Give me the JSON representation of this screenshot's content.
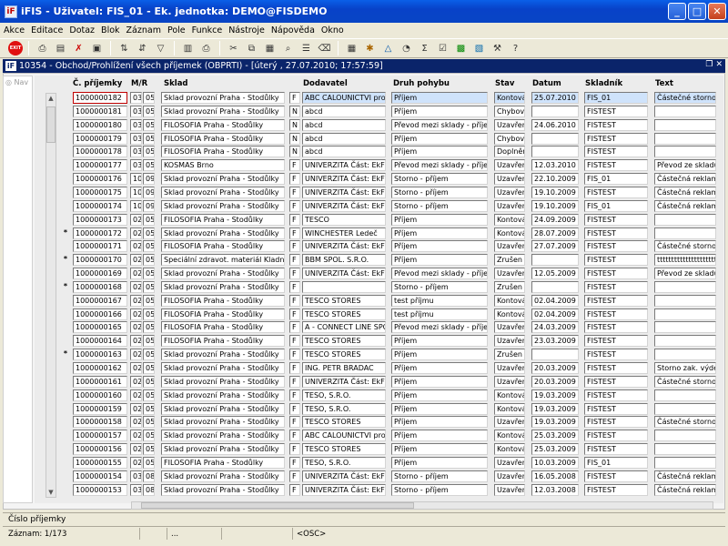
{
  "window": {
    "app_icon": "iF",
    "title": "iFIS - Uživatel: FIS_01 - Ek. jednotka: DEMO@FISDEMO",
    "buttons": [
      "_",
      "□",
      "✕"
    ]
  },
  "menu": [
    "Akce",
    "Editace",
    "Dotaz",
    "Blok",
    "Záznam",
    "Pole",
    "Funkce",
    "Nástroje",
    "Nápověda",
    "Okno"
  ],
  "toolbar": {
    "exit_label": "EXIT",
    "icons": [
      "exit-icon",
      "print-icon",
      "insert-record-icon",
      "delete-record-icon",
      "save-icon",
      "sort-asc-icon",
      "sort-desc-icon",
      "filter-icon",
      "print-preview-icon",
      "printer-icon",
      "cut-icon",
      "copy-icon",
      "paste-icon",
      "find-icon",
      "list-icon",
      "clear-icon",
      "calculator-icon",
      "settings-icon",
      "warning-icon",
      "cycle-icon",
      "sum-icon",
      "edit-icon",
      "excel-icon",
      "export-icon",
      "tools-icon",
      "help-icon"
    ]
  },
  "subwindow": {
    "icon": "iF",
    "title": "10354 - Obchod/Prohlížení všech příjemek (OBPRTI) - [úterý , 27.07.2010; 17:57:59]",
    "buttons": [
      "❐",
      "✕"
    ]
  },
  "nav": {
    "label": "Nav"
  },
  "columns": {
    "cislo": "Č. příjemky",
    "mr": "M/R",
    "sklad": "Sklad",
    "dodavatel": "Dodavatel",
    "druh": "Druh pohybu",
    "stav": "Stav",
    "datum": "Datum",
    "skladnik": "Skladník",
    "text": "Text"
  },
  "rows": [
    {
      "mark": "",
      "cislo": "1000000182",
      "m": "03",
      "r": "05",
      "sklad": "Sklad provozní Praha - Stodůlky",
      "typ": "F",
      "dod": "ABC CALOUNICTVI pro",
      "druh": "Příjem",
      "stav": "Kontová",
      "datum": "25.07.2010",
      "skladnik": "FIS_01",
      "text": "Částečné storno"
    },
    {
      "mark": "",
      "cislo": "1000000181",
      "m": "03",
      "r": "05",
      "sklad": "Sklad provozní Praha - Stodůlky",
      "typ": "N",
      "dod": "abcd",
      "druh": "Příjem",
      "stav": "Chybový",
      "datum": "",
      "skladnik": "FISTEST",
      "text": ""
    },
    {
      "mark": "",
      "cislo": "1000000180",
      "m": "03",
      "r": "05",
      "sklad": "FILOSOFIA Praha - Stodůlky",
      "typ": "N",
      "dod": "abcd",
      "druh": "Převod mezi sklady - příjem",
      "stav": "Uzavřen",
      "datum": "24.06.2010",
      "skladnik": "FISTEST",
      "text": ""
    },
    {
      "mark": "",
      "cislo": "1000000179",
      "m": "03",
      "r": "05",
      "sklad": "FILOSOFIA Praha - Stodůlky",
      "typ": "N",
      "dod": "abcd",
      "druh": "Příjem",
      "stav": "Chybový",
      "datum": "",
      "skladnik": "FISTEST",
      "text": ""
    },
    {
      "mark": "",
      "cislo": "1000000178",
      "m": "03",
      "r": "05",
      "sklad": "FILOSOFIA Praha - Stodůlky",
      "typ": "N",
      "dod": "abcd",
      "druh": "Příjem",
      "stav": "Doplnění",
      "datum": "",
      "skladnik": "FISTEST",
      "text": ""
    },
    {
      "mark": "",
      "cislo": "1000000177",
      "m": "03",
      "r": "05",
      "sklad": "KOSMAS Brno",
      "typ": "F",
      "dod": "UNIVERZITA Část: EkF",
      "druh": "Převod mezi sklady - příjem",
      "stav": "Uzavřen",
      "datum": "12.03.2010",
      "skladnik": "FISTEST",
      "text": "Převod ze skladu"
    },
    {
      "mark": "",
      "cislo": "1000000176",
      "m": "10",
      "r": "09",
      "sklad": "Sklad provozní Praha - Stodůlky",
      "typ": "F",
      "dod": "UNIVERZITA Část: EkF",
      "druh": "Storno - příjem",
      "stav": "Uzavřen",
      "datum": "22.10.2009",
      "skladnik": "FIS_01",
      "text": "Částečná reklama"
    },
    {
      "mark": "",
      "cislo": "1000000175",
      "m": "10",
      "r": "09",
      "sklad": "Sklad provozní Praha - Stodůlky",
      "typ": "F",
      "dod": "UNIVERZITA Část: EkF",
      "druh": "Storno - příjem",
      "stav": "Uzavřen",
      "datum": "19.10.2009",
      "skladnik": "FISTEST",
      "text": "Částečná reklama"
    },
    {
      "mark": "",
      "cislo": "1000000174",
      "m": "10",
      "r": "09",
      "sklad": "Sklad provozní Praha - Stodůlky",
      "typ": "F",
      "dod": "UNIVERZITA Část: EkF",
      "druh": "Storno - příjem",
      "stav": "Uzavřen",
      "datum": "19.10.2009",
      "skladnik": "FIS_01",
      "text": "Částečná reklama"
    },
    {
      "mark": "",
      "cislo": "1000000173",
      "m": "02",
      "r": "05",
      "sklad": "FILOSOFIA Praha - Stodůlky",
      "typ": "F",
      "dod": "TESCO",
      "druh": "Příjem",
      "stav": "Kontová",
      "datum": "24.09.2009",
      "skladnik": "FISTEST",
      "text": ""
    },
    {
      "mark": "*",
      "cislo": "1000000172",
      "m": "02",
      "r": "05",
      "sklad": "Sklad provozní Praha - Stodůlky",
      "typ": "F",
      "dod": "WINCHESTER Ledeč",
      "druh": "Příjem",
      "stav": "Kontová",
      "datum": "28.07.2009",
      "skladnik": "FISTEST",
      "text": ""
    },
    {
      "mark": "",
      "cislo": "1000000171",
      "m": "02",
      "r": "05",
      "sklad": "FILOSOFIA Praha - Stodůlky",
      "typ": "F",
      "dod": "UNIVERZITA Část: EkF",
      "druh": "Příjem",
      "stav": "Uzavřen",
      "datum": "27.07.2009",
      "skladnik": "FISTEST",
      "text": "Částečné storno"
    },
    {
      "mark": "*",
      "cislo": "1000000170",
      "m": "02",
      "r": "05",
      "sklad": "Speciální zdravot. materiál Kladno",
      "typ": "F",
      "dod": "BBM SPOL. S.R.O.",
      "druh": "Příjem",
      "stav": "Zrušen",
      "datum": "",
      "skladnik": "FISTEST",
      "text": "ttttttttttttttttttttt"
    },
    {
      "mark": "",
      "cislo": "1000000169",
      "m": "02",
      "r": "05",
      "sklad": "Sklad provozní Praha - Stodůlky",
      "typ": "F",
      "dod": "UNIVERZITA Část: EkF",
      "druh": "Převod mezi sklady - příjem",
      "stav": "Uzavřen",
      "datum": "12.05.2009",
      "skladnik": "FISTEST",
      "text": "Převod ze skladu"
    },
    {
      "mark": "*",
      "cislo": "1000000168",
      "m": "02",
      "r": "05",
      "sklad": "Sklad provozní Praha - Stodůlky",
      "typ": "F",
      "dod": "",
      "druh": "Storno - příjem",
      "stav": "Zrušen",
      "datum": "",
      "skladnik": "FISTEST",
      "text": ""
    },
    {
      "mark": "",
      "cislo": "1000000167",
      "m": "02",
      "r": "05",
      "sklad": "FILOSOFIA Praha - Stodůlky",
      "typ": "F",
      "dod": "TESCO STORES",
      "druh": "test příjmu",
      "stav": "Kontová",
      "datum": "02.04.2009",
      "skladnik": "FISTEST",
      "text": ""
    },
    {
      "mark": "",
      "cislo": "1000000166",
      "m": "02",
      "r": "05",
      "sklad": "FILOSOFIA Praha - Stodůlky",
      "typ": "F",
      "dod": "TESCO STORES",
      "druh": "test příjmu",
      "stav": "Kontová",
      "datum": "02.04.2009",
      "skladnik": "FISTEST",
      "text": ""
    },
    {
      "mark": "",
      "cislo": "1000000165",
      "m": "02",
      "r": "05",
      "sklad": "FILOSOFIA Praha - Stodůlky",
      "typ": "F",
      "dod": "A - CONNECT LINE SPO",
      "druh": "Převod mezi sklady - příjem",
      "stav": "Uzavřen",
      "datum": "24.03.2009",
      "skladnik": "FISTEST",
      "text": ""
    },
    {
      "mark": "",
      "cislo": "1000000164",
      "m": "02",
      "r": "05",
      "sklad": "FILOSOFIA Praha - Stodůlky",
      "typ": "F",
      "dod": "TESCO STORES",
      "druh": "Příjem",
      "stav": "Uzavřen",
      "datum": "23.03.2009",
      "skladnik": "FISTEST",
      "text": ""
    },
    {
      "mark": "*",
      "cislo": "1000000163",
      "m": "02",
      "r": "05",
      "sklad": "Sklad provozní Praha - Stodůlky",
      "typ": "F",
      "dod": "TESCO STORES",
      "druh": "Příjem",
      "stav": "Zrušen",
      "datum": "",
      "skladnik": "FISTEST",
      "text": ""
    },
    {
      "mark": "",
      "cislo": "1000000162",
      "m": "02",
      "r": "05",
      "sklad": "Sklad provozní Praha - Stodůlky",
      "typ": "F",
      "dod": "ING. PETR BRADAC",
      "druh": "Příjem",
      "stav": "Uzavřen",
      "datum": "20.03.2009",
      "skladnik": "FISTEST",
      "text": "Storno zak. výdej"
    },
    {
      "mark": "",
      "cislo": "1000000161",
      "m": "02",
      "r": "05",
      "sklad": "Sklad provozní Praha - Stodůlky",
      "typ": "F",
      "dod": "UNIVERZITA Část: EkF",
      "druh": "Příjem",
      "stav": "Uzavřen",
      "datum": "20.03.2009",
      "skladnik": "FISTEST",
      "text": "Částečné storno"
    },
    {
      "mark": "",
      "cislo": "1000000160",
      "m": "02",
      "r": "05",
      "sklad": "Sklad provozní Praha - Stodůlky",
      "typ": "F",
      "dod": "TESO, S.R.O.",
      "druh": "Příjem",
      "stav": "Kontová",
      "datum": "19.03.2009",
      "skladnik": "FISTEST",
      "text": ""
    },
    {
      "mark": "",
      "cislo": "1000000159",
      "m": "02",
      "r": "05",
      "sklad": "Sklad provozní Praha - Stodůlky",
      "typ": "F",
      "dod": "TESO, S.R.O.",
      "druh": "Příjem",
      "stav": "Kontová",
      "datum": "19.03.2009",
      "skladnik": "FISTEST",
      "text": ""
    },
    {
      "mark": "",
      "cislo": "1000000158",
      "m": "02",
      "r": "05",
      "sklad": "Sklad provozní Praha - Stodůlky",
      "typ": "F",
      "dod": "TESCO STORES",
      "druh": "Příjem",
      "stav": "Uzavřen",
      "datum": "19.03.2009",
      "skladnik": "FISTEST",
      "text": "Částečné storno"
    },
    {
      "mark": "",
      "cislo": "1000000157",
      "m": "02",
      "r": "05",
      "sklad": "Sklad provozní Praha - Stodůlky",
      "typ": "F",
      "dod": "ABC CALOUNICTVI pro",
      "druh": "Příjem",
      "stav": "Kontová",
      "datum": "25.03.2009",
      "skladnik": "FISTEST",
      "text": ""
    },
    {
      "mark": "",
      "cislo": "1000000156",
      "m": "02",
      "r": "05",
      "sklad": "Sklad provozní Praha - Stodůlky",
      "typ": "F",
      "dod": "TESCO STORES",
      "druh": "Příjem",
      "stav": "Kontová",
      "datum": "25.03.2009",
      "skladnik": "FISTEST",
      "text": ""
    },
    {
      "mark": "",
      "cislo": "1000000155",
      "m": "02",
      "r": "05",
      "sklad": "FILOSOFIA Praha - Stodůlky",
      "typ": "F",
      "dod": "TESO, S.R.O.",
      "druh": "Příjem",
      "stav": "Uzavřen",
      "datum": "10.03.2009",
      "skladnik": "FIS_01",
      "text": ""
    },
    {
      "mark": "",
      "cislo": "1000000154",
      "m": "03",
      "r": "08",
      "sklad": "Sklad provozní Praha - Stodůlky",
      "typ": "F",
      "dod": "UNIVERZITA Část: EkF",
      "druh": "Storno - příjem",
      "stav": "Uzavřen",
      "datum": "16.05.2008",
      "skladnik": "FISTEST",
      "text": "Částečná reklama"
    },
    {
      "mark": "",
      "cislo": "1000000153",
      "m": "03",
      "r": "08",
      "sklad": "Sklad provozní Praha - Stodůlky",
      "typ": "F",
      "dod": "UNIVERZITA Část: EkF",
      "druh": "Storno - příjem",
      "stav": "Uzavřen",
      "datum": "12.03.2008",
      "skladnik": "FISTEST",
      "text": "Částečná reklama"
    }
  ],
  "status": {
    "field": "Číslo příjemky",
    "record": "Záznam: 1/173",
    "seg2": "...",
    "seg3": "",
    "mode": "<OSC>"
  }
}
